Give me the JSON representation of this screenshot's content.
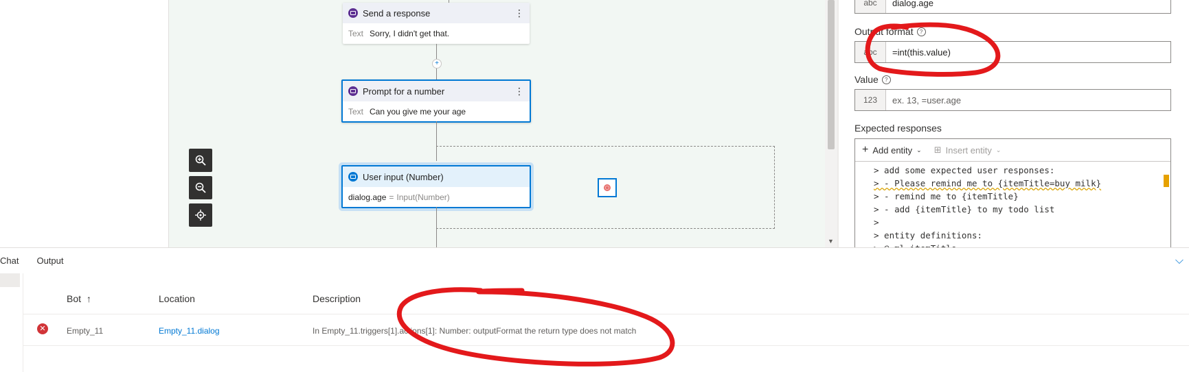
{
  "canvas": {
    "send_response": {
      "title": "Send a response",
      "field_key": "Text",
      "field_value": "Sorry, I didn't get that."
    },
    "prompt_number": {
      "title": "Prompt for a number",
      "field_key": "Text",
      "field_value": "Can you give me your age"
    },
    "user_input": {
      "title": "User input (Number)",
      "binding": "dialog.age",
      "equals": "=",
      "expr": "Input(Number)"
    },
    "menu_glyph": "⋮",
    "plus_glyph": "+"
  },
  "zoom_controls": [
    "zoom-in-icon",
    "zoom-out-icon",
    "fit-to-screen-icon"
  ],
  "properties": {
    "property_field": {
      "prefix": "abc",
      "value": "dialog.age"
    },
    "output_format": {
      "label": "Output format",
      "prefix": "abc",
      "value": "=int(this.value)"
    },
    "value": {
      "label": "Value",
      "prefix": "123",
      "placeholder": "ex. 13, =user.age"
    },
    "expected_responses": {
      "label": "Expected responses",
      "add_entity": "Add entity",
      "insert_entity": "Insert entity",
      "lines": [
        "> add some expected user responses:",
        "> - Please remind me to {itemTitle=buy milk}",
        "> - remind me to {itemTitle}",
        "> - add {itemTitle} to my todo list",
        ">",
        "> entity definitions:",
        "> @ ml itemTitle"
      ]
    },
    "help_glyph": "?"
  },
  "output_panel": {
    "tabs": [
      "Chat",
      "Output"
    ],
    "columns": {
      "bot": "Bot",
      "sort_arrow": "↑",
      "location": "Location",
      "description": "Description"
    },
    "rows": [
      {
        "status": "error",
        "bot": "Empty_11",
        "location": "Empty_11.dialog",
        "description": "In Empty_11.triggers[1].actions[1]: Number: outputFormat the return type does not match"
      }
    ]
  },
  "colors": {
    "accent": "#0078d4",
    "error": "#d13438",
    "annotation": "#e3191b",
    "canvas_bg": "#f2f7f3"
  }
}
